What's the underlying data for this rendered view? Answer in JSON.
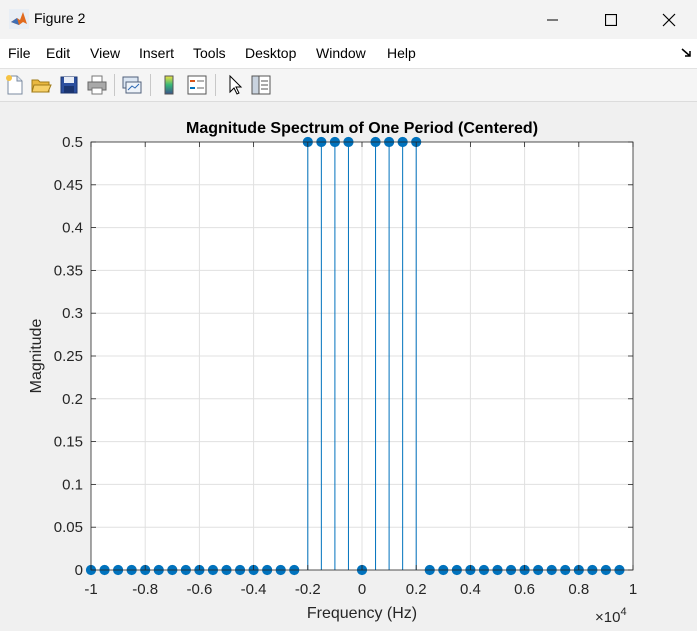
{
  "window": {
    "title": "Figure 2",
    "minimize_icon": "minimize-icon",
    "maximize_icon": "maximize-icon",
    "close_icon": "close-icon"
  },
  "menubar": {
    "items": [
      "File",
      "Edit",
      "View",
      "Insert",
      "Tools",
      "Desktop",
      "Window",
      "Help"
    ],
    "dock_icon": "dock-arrow-icon"
  },
  "toolbar": {
    "icons": [
      "new-figure-icon",
      "open-file-icon",
      "save-icon",
      "print-icon",
      "link-plot-icon",
      "colorbar-icon",
      "legend-icon",
      "pointer-icon",
      "property-inspector-icon"
    ]
  },
  "chart_data": {
    "type": "stem",
    "title": "Magnitude Spectrum of One Period (Centered)",
    "xlabel": "Frequency (Hz)",
    "ylabel": "Magnitude",
    "x_exponent_label": "×10",
    "x_exponent_power": "4",
    "xlim": [
      -10000,
      10000
    ],
    "ylim": [
      0,
      0.5
    ],
    "grid": true,
    "x_ticks": [
      -10000,
      -8000,
      -6000,
      -4000,
      -2000,
      0,
      2000,
      4000,
      6000,
      8000,
      10000
    ],
    "x_tick_labels": [
      "-1",
      "-0.8",
      "-0.6",
      "-0.4",
      "-0.2",
      "0",
      "0.2",
      "0.4",
      "0.6",
      "0.8",
      "1"
    ],
    "y_ticks": [
      0,
      0.05,
      0.1,
      0.15,
      0.2,
      0.25,
      0.3,
      0.35,
      0.4,
      0.45,
      0.5
    ],
    "y_tick_labels": [
      "0",
      "0.05",
      "0.1",
      "0.15",
      "0.2",
      "0.25",
      "0.3",
      "0.35",
      "0.4",
      "0.45",
      "0.5"
    ],
    "color": "#0072bd",
    "x": [
      -10000,
      -9500,
      -9000,
      -8500,
      -8000,
      -7500,
      -7000,
      -6500,
      -6000,
      -5500,
      -5000,
      -4500,
      -4000,
      -3500,
      -3000,
      -2500,
      -2000,
      -1500,
      -1000,
      -500,
      0,
      500,
      1000,
      1500,
      2000,
      2500,
      3000,
      3500,
      4000,
      4500,
      5000,
      5500,
      6000,
      6500,
      7000,
      7500,
      8000,
      8500,
      9000,
      9500
    ],
    "y": [
      0,
      0,
      0,
      0,
      0,
      0,
      0,
      0,
      0,
      0,
      0,
      0,
      0,
      0,
      0,
      0,
      0.5,
      0.5,
      0.5,
      0.5,
      0,
      0.5,
      0.5,
      0.5,
      0.5,
      0,
      0,
      0,
      0,
      0,
      0,
      0,
      0,
      0,
      0,
      0,
      0,
      0,
      0,
      0
    ]
  }
}
